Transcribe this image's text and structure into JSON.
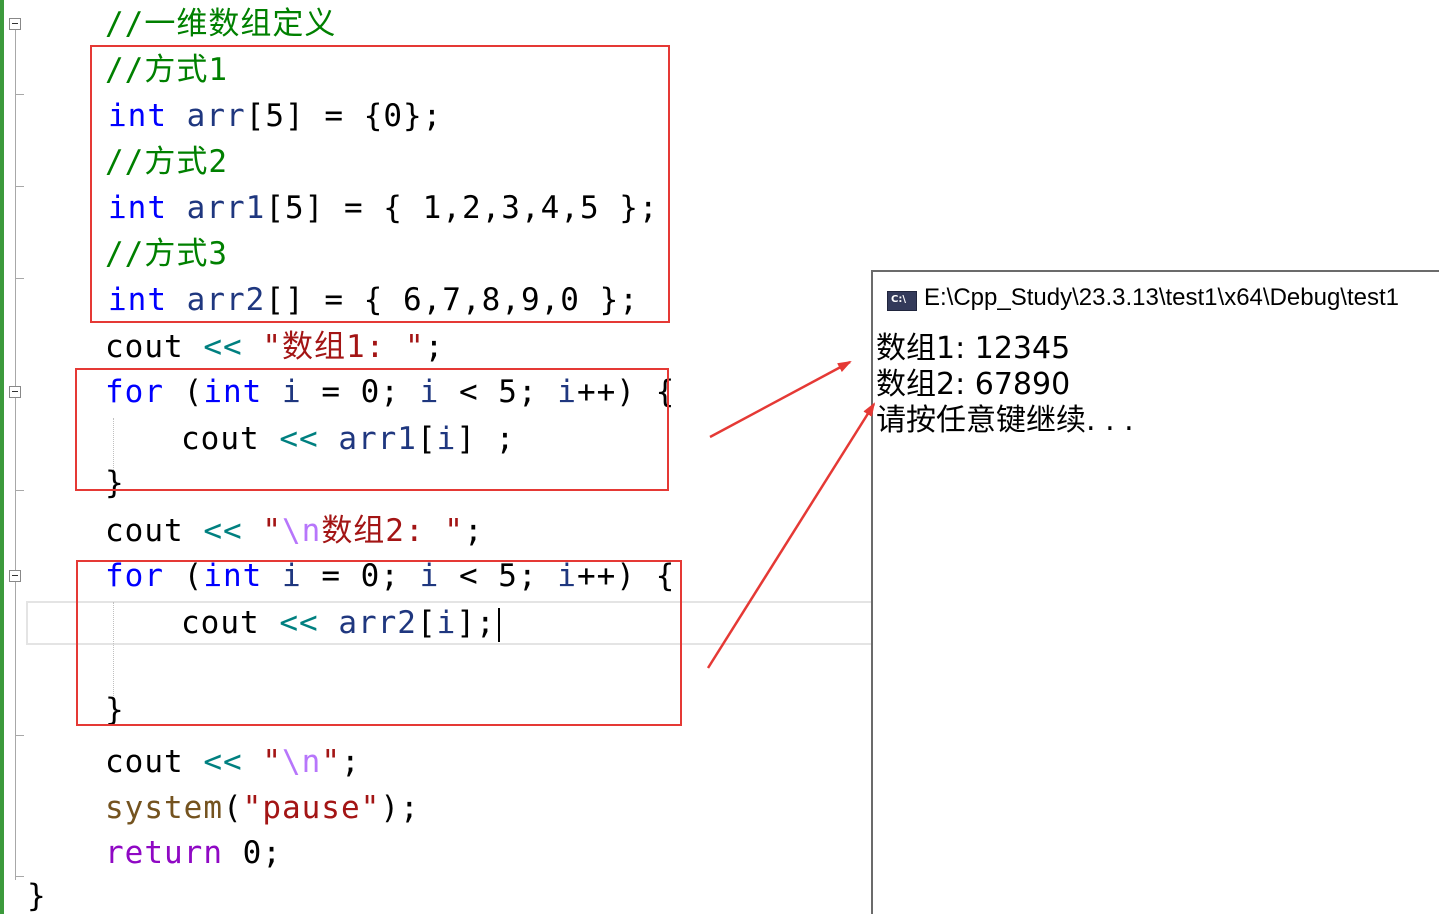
{
  "editor": {
    "lines": {
      "c_title": "//一维数组定义",
      "c1": "//方式1",
      "l1_kw": "int",
      "l1_id": "arr",
      "l1_rest": "[5] = {0};",
      "c2": "//方式2",
      "l2_kw": "int",
      "l2_id": "arr1",
      "l2_rest": "[5] = { 1,2,3,4,5 };",
      "c3": "//方式3",
      "l3_kw": "int",
      "l3_id": "arr2",
      "l3_rest": "[] = { 6,7,8,9,0 };",
      "cout1_a": "cout",
      "cout1_op": " << ",
      "cout1_str": "\"数组1: \"",
      "cout1_end": ";",
      "for1_for": "for",
      "for1_p": " (",
      "for1_int": "int",
      "for1_i": " i",
      "for1_mid": " = 0; ",
      "for1_i2": "i",
      "for1_lt": " < 5; ",
      "for1_i3": "i",
      "for1_end": "++) {",
      "body1_cout": "cout",
      "body1_op": " << ",
      "body1_id": "arr1",
      "body1_b": "[",
      "body1_i": "i",
      "body1_end": "] ;",
      "close1": "}",
      "cout2_a": "cout",
      "cout2_op": " << ",
      "cout2_q": "\"",
      "cout2_esc": "\\n",
      "cout2_str": "数组2: \"",
      "cout2_end": ";",
      "for2_for": "for",
      "for2_p": " (",
      "for2_int": "int",
      "for2_i": " i",
      "for2_mid": " = 0; ",
      "for2_i2": "i",
      "for2_lt": " < 5; ",
      "for2_i3": "i",
      "for2_end": "++) {",
      "body2_cout": "cout",
      "body2_op": " << ",
      "body2_id": "arr2",
      "body2_b": "[",
      "body2_i": "i",
      "body2_end": "];",
      "close2": "}",
      "cout3_a": "cout",
      "cout3_op": " << ",
      "cout3_q1": "\"",
      "cout3_esc": "\\n",
      "cout3_q2": "\"",
      "cout3_end": ";",
      "sys_fn": "system",
      "sys_p": "(",
      "sys_str": "\"pause\"",
      "sys_end": ");",
      "ret_kw": "return",
      "ret_rest": " 0;",
      "close_main": "}"
    }
  },
  "console": {
    "title": "E:\\Cpp_Study\\23.3.13\\test1\\x64\\Debug\\test1",
    "icon": "console-app-icon",
    "icon_text": "C:\\",
    "output": [
      "数组1: 12345",
      "数组2: 67890",
      "请按任意键继续. . ."
    ]
  },
  "annotations": {
    "box_color": "#e53935",
    "arrow_color": "#e53935"
  }
}
